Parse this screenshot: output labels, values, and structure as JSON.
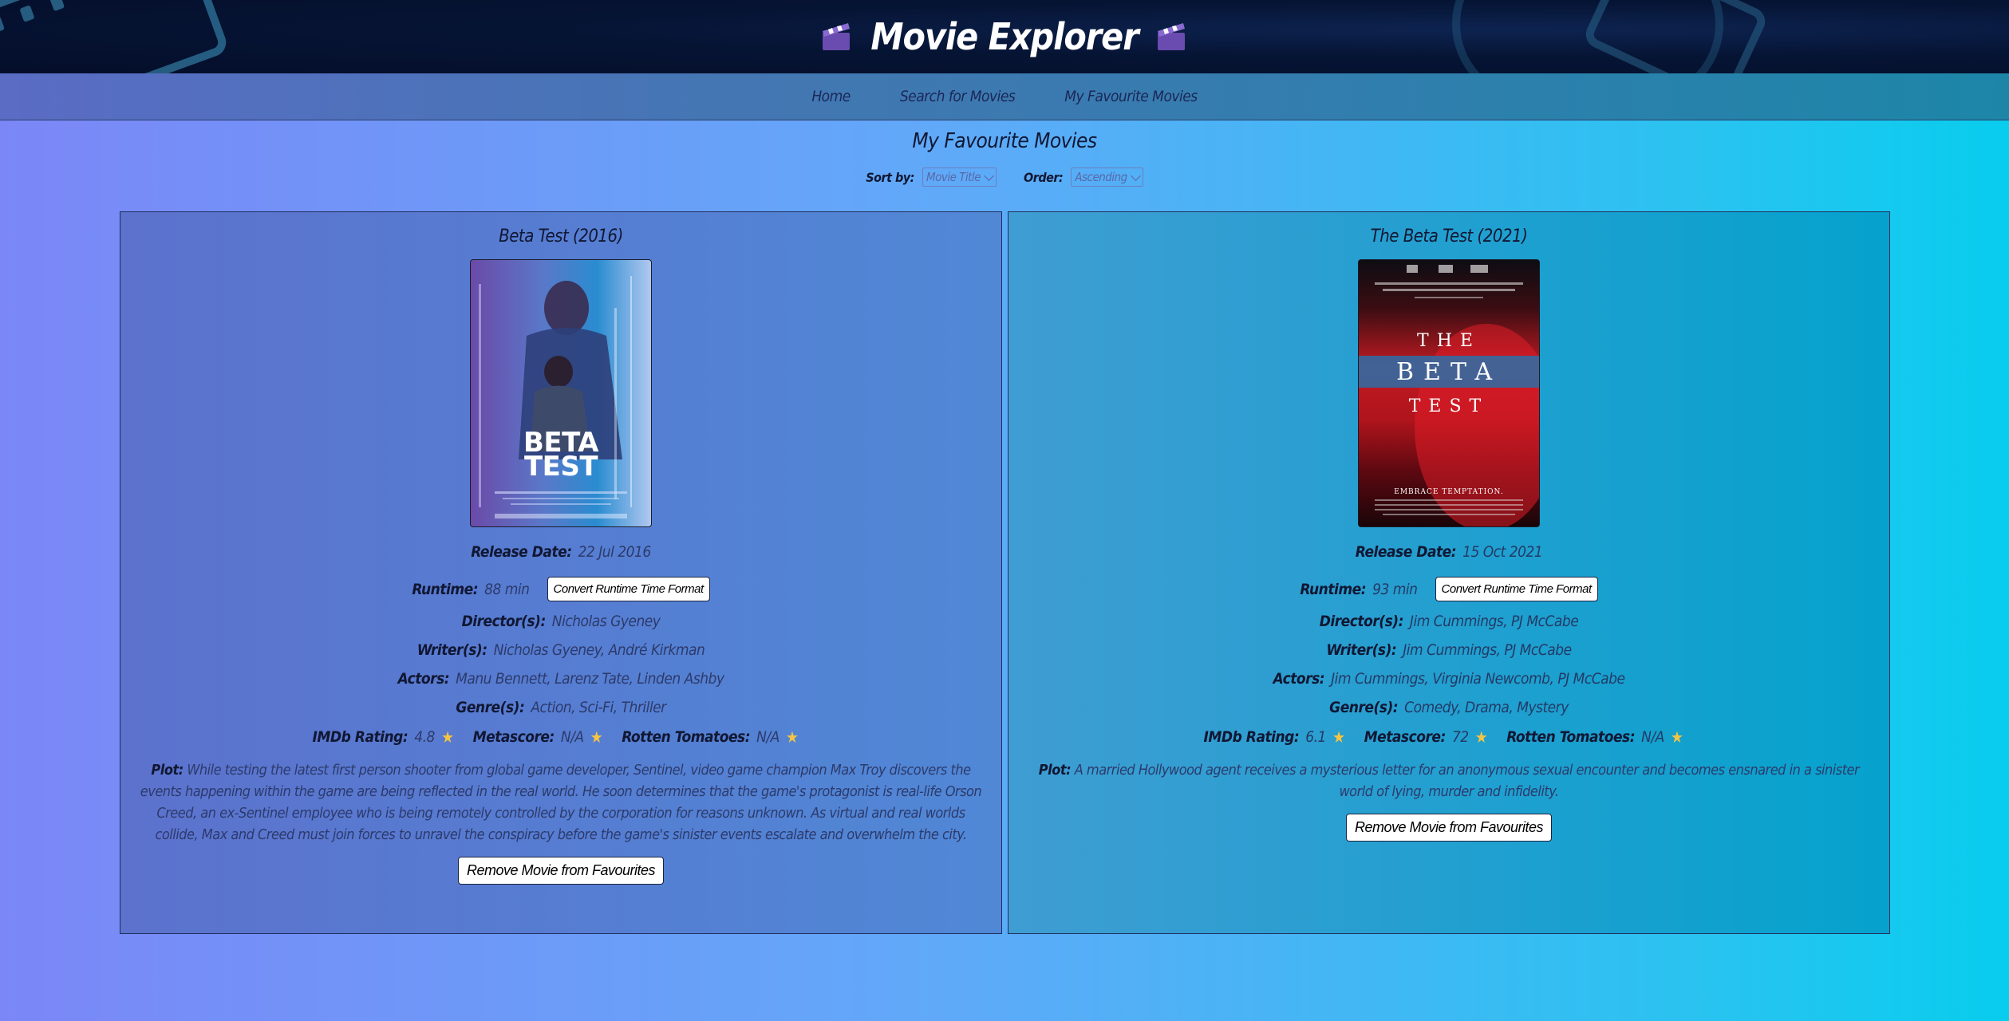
{
  "header": {
    "title": "Movie Explorer",
    "left_icon": "clapperboard-icon",
    "right_icon": "clapperboard-icon"
  },
  "nav": {
    "items": [
      {
        "label": "Home"
      },
      {
        "label": "Search for Movies"
      },
      {
        "label": "My Favourite Movies"
      }
    ]
  },
  "page": {
    "title": "My Favourite Movies",
    "sort_by_label": "Sort by:",
    "sort_by_value": "Movie Title",
    "order_label": "Order:",
    "order_value": "Ascending"
  },
  "labels": {
    "release_date": "Release Date:",
    "runtime": "Runtime:",
    "directors": "Director(s):",
    "writers": "Writer(s):",
    "actors": "Actors:",
    "genres": "Genre(s):",
    "imdb": "IMDb Rating:",
    "metascore": "Metascore:",
    "rotten": "Rotten Tomatoes:",
    "plot": "Plot:",
    "convert_button": "Convert Runtime Time Format",
    "remove_button": "Remove Movie from Favourites",
    "rating_icon": "star-icon"
  },
  "movies": [
    {
      "title": "Beta Test (2016)",
      "release_date": "22 Jul 2016",
      "runtime": "88 min",
      "directors": "Nicholas Gyeney",
      "writers": "Nicholas Gyeney, André Kirkman",
      "actors": "Manu Bennett, Larenz Tate, Linden Ashby",
      "genres": "Action, Sci-Fi, Thriller",
      "imdb": "4.8",
      "metascore": "N/A",
      "rotten": "N/A",
      "plot": "While testing the latest first person shooter from global game developer, Sentinel, video game champion Max Troy discovers the events happening within the game are being reflected in the real world. He soon determines that the game's protagonist is real-life Orson Creed, an ex-Sentinel employee who is being remotely controlled by the corporation for reasons unknown. As virtual and real worlds collide, Max and Creed must join forces to unravel the conspiracy before the game's sinister events escalate and overwhelm the city.",
      "poster": {
        "title_line1": "BETA",
        "title_line2": "TEST"
      }
    },
    {
      "title": "The Beta Test (2021)",
      "release_date": "15 Oct 2021",
      "runtime": "93 min",
      "directors": "Jim Cummings, PJ McCabe",
      "writers": "Jim Cummings, PJ McCabe",
      "actors": "Jim Cummings, Virginia Newcomb, PJ McCabe",
      "genres": "Comedy, Drama, Mystery",
      "imdb": "6.1",
      "metascore": "72",
      "rotten": "N/A",
      "plot": "A married Hollywood agent receives a mysterious letter for an anonymous sexual encounter and becomes ensnared in a sinister world of lying, murder and infidelity.",
      "poster": {
        "title_line1": "THE",
        "title_line2": "BETA",
        "title_line3": "TEST",
        "tagline": "EMBRACE TEMPTATION."
      }
    }
  ]
}
